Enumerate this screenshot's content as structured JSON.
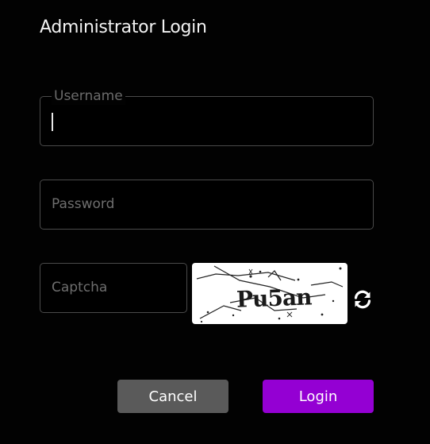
{
  "dialog": {
    "title": "Administrator Login"
  },
  "username": {
    "label": "Username",
    "value": ""
  },
  "password": {
    "placeholder": "Password",
    "value": ""
  },
  "captcha": {
    "placeholder": "Captcha",
    "value": "",
    "image_text": "Pu5an",
    "refresh_icon": "refresh-icon"
  },
  "buttons": {
    "cancel_label": "Cancel",
    "login_label": "Login"
  },
  "colors": {
    "background": "#000000",
    "field_border": "#4a4a4a",
    "cancel_button": "#5a5a5a",
    "login_button": "#9400d3"
  }
}
